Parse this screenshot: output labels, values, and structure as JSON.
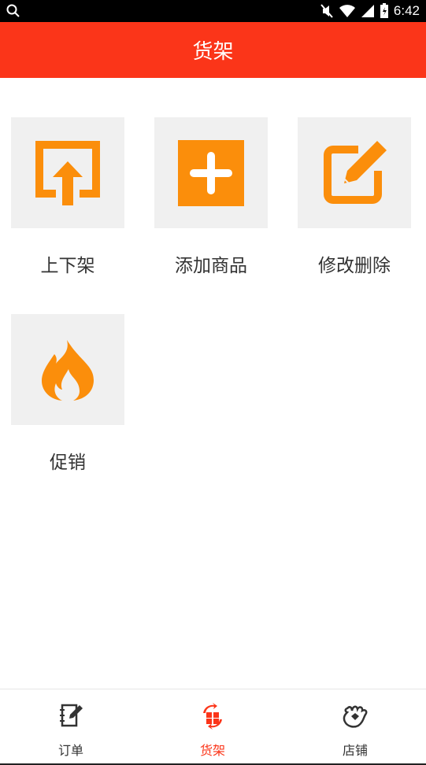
{
  "status_bar": {
    "time": "6:42"
  },
  "header": {
    "title": "货架"
  },
  "grid": {
    "items": [
      {
        "label": "上下架",
        "icon": "shelf-upload-icon"
      },
      {
        "label": "添加商品",
        "icon": "add-product-icon"
      },
      {
        "label": "修改删除",
        "icon": "edit-delete-icon"
      },
      {
        "label": "促销",
        "icon": "promotion-fire-icon"
      }
    ]
  },
  "bottom_nav": {
    "items": [
      {
        "label": "订单",
        "icon": "orders-icon",
        "active": false
      },
      {
        "label": "货架",
        "icon": "shelf-icon",
        "active": true
      },
      {
        "label": "店铺",
        "icon": "shop-icon",
        "active": false
      }
    ]
  },
  "colors": {
    "primary": "#fb3519",
    "icon_orange": "#fb8e0b",
    "tile_bg": "#f0f0f0"
  }
}
